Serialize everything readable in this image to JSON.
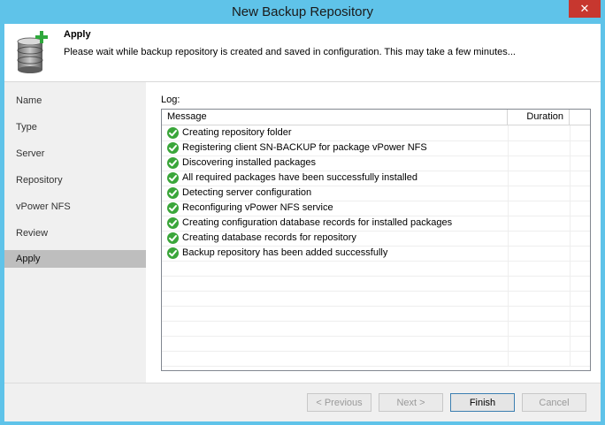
{
  "window": {
    "title": "New Backup Repository",
    "close_glyph": "✕"
  },
  "header": {
    "title": "Apply",
    "description": "Please wait while backup repository is created and saved in configuration. This may take a few minutes...",
    "icon": "database-add-icon"
  },
  "nav": {
    "items": [
      {
        "label": "Name"
      },
      {
        "label": "Type"
      },
      {
        "label": "Server"
      },
      {
        "label": "Repository"
      },
      {
        "label": "vPower NFS"
      },
      {
        "label": "Review"
      },
      {
        "label": "Apply"
      }
    ],
    "active": "Apply"
  },
  "log": {
    "label": "Log:",
    "columns": {
      "message": "Message",
      "duration": "Duration"
    },
    "rows": [
      {
        "message": "Creating repository folder",
        "status_icon": "success-check-icon"
      },
      {
        "message": "Registering client SN-BACKUP for package vPower NFS",
        "status_icon": "success-check-icon"
      },
      {
        "message": "Discovering installed packages",
        "status_icon": "success-check-icon"
      },
      {
        "message": "All required packages have been successfully installed",
        "status_icon": "success-check-icon"
      },
      {
        "message": "Detecting server configuration",
        "status_icon": "success-check-icon"
      },
      {
        "message": "Reconfiguring vPower NFS service",
        "status_icon": "success-check-icon"
      },
      {
        "message": "Creating configuration database records for installed packages",
        "status_icon": "success-check-icon"
      },
      {
        "message": "Creating database records for repository",
        "status_icon": "success-check-icon"
      },
      {
        "message": "Backup repository has been added successfully",
        "status_icon": "success-check-icon"
      }
    ]
  },
  "buttons": {
    "previous": "< Previous",
    "next": "Next >",
    "finish": "Finish",
    "cancel": "Cancel"
  },
  "colors": {
    "titlebar": "#5fc3e9",
    "close": "#c7372f",
    "success": "#3aa63a",
    "nav_active": "#bebebe"
  }
}
